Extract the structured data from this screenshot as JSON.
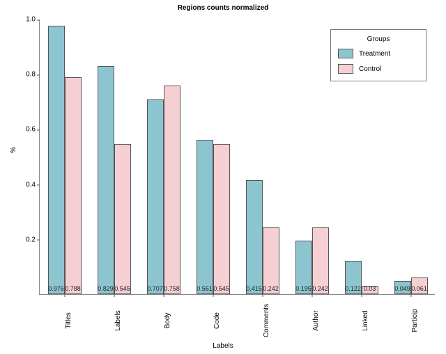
{
  "chart_data": {
    "type": "bar",
    "title": "Regions counts normalized",
    "xlabel": "Labels",
    "ylabel": "%",
    "ylim": [
      0,
      1.0
    ],
    "yticks": [
      0.2,
      0.4,
      0.6,
      0.8,
      1.0
    ],
    "categories": [
      "Titles",
      "Labels",
      "Body",
      "Code",
      "Comments",
      "Author",
      "Linked",
      "Particip"
    ],
    "series": [
      {
        "name": "Treatment",
        "color": "#8cc5d0",
        "values": [
          0.976,
          0.829,
          0.707,
          0.561,
          0.415,
          0.195,
          0.122,
          0.049
        ]
      },
      {
        "name": "Control",
        "color": "#f6cfd3",
        "values": [
          0.788,
          0.545,
          0.758,
          0.545,
          0.242,
          0.242,
          0.03,
          0.061
        ]
      }
    ],
    "legend": {
      "title": "Groups",
      "position": "top-right"
    }
  }
}
